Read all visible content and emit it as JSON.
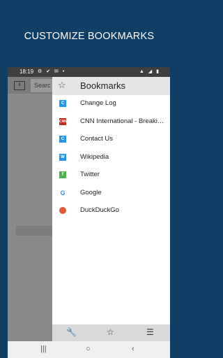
{
  "headline": "CUSTOMIZE BOOKMARKS",
  "status": {
    "time": "18:19",
    "left_icons": "⚙ ✔ ✉ •",
    "right_icons": "▲ ◢ ▮"
  },
  "background_ui": {
    "tabs_count": "4",
    "url_placeholder": "Searc"
  },
  "drawer": {
    "title": "Bookmarks",
    "star_icon": "☆",
    "items": [
      {
        "label": "Change Log",
        "icon": "C",
        "icon_name": "page-c-icon"
      },
      {
        "label": "CNN International - Breaking News",
        "icon": "CNN",
        "icon_name": "cnn-icon"
      },
      {
        "label": "Contact Us",
        "icon": "C",
        "icon_name": "page-c-icon"
      },
      {
        "label": "Wikipedia",
        "icon": "W",
        "icon_name": "wikipedia-icon"
      },
      {
        "label": "Twitter",
        "icon": "T",
        "icon_name": "twitter-icon"
      },
      {
        "label": "Google",
        "icon": "G",
        "icon_name": "google-icon"
      },
      {
        "label": "DuckDuckGo",
        "icon": "",
        "icon_name": "duckduckgo-icon"
      }
    ]
  },
  "bottom_tools": {
    "wrench": "🔧",
    "star": "☆",
    "list": "☰"
  },
  "navbar": {
    "recents": "|||",
    "home": "○",
    "back": "‹"
  }
}
